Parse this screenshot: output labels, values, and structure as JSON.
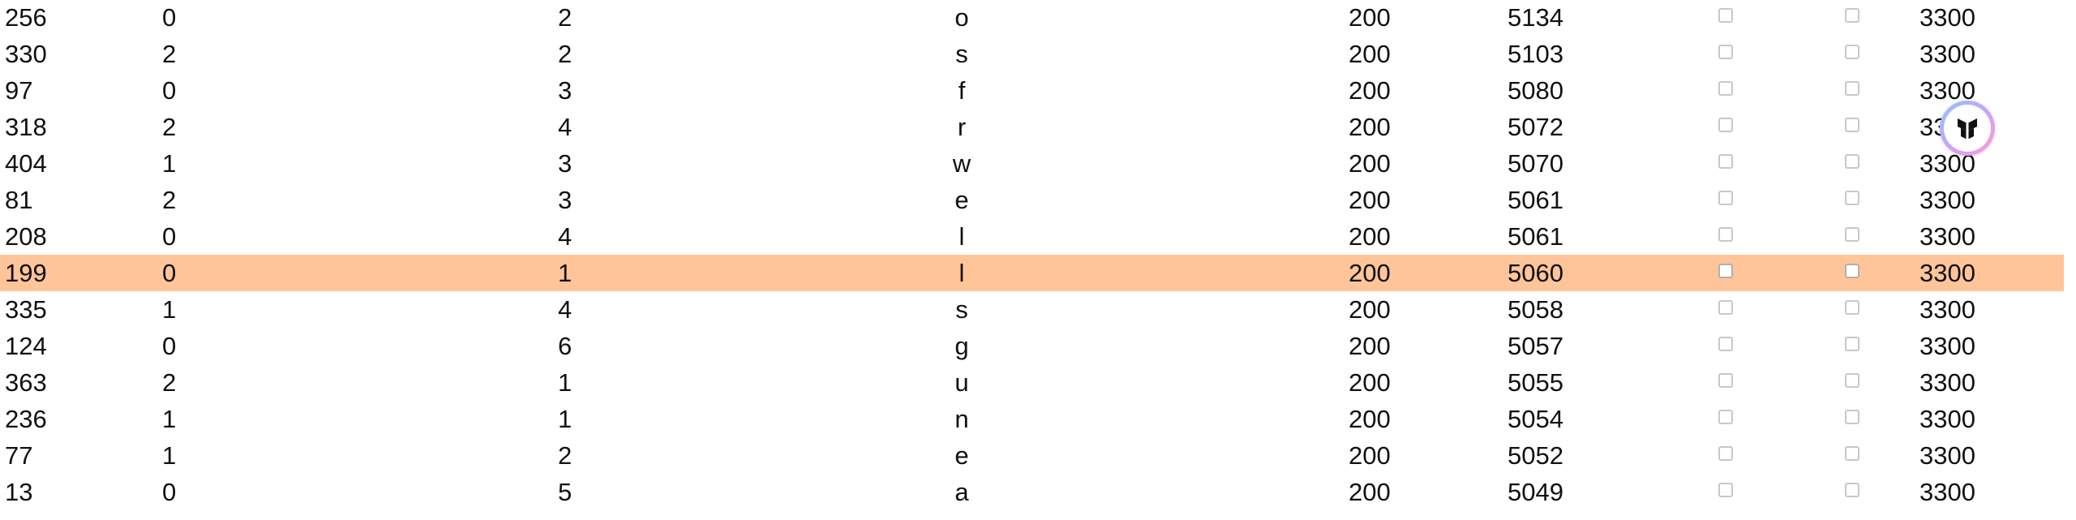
{
  "table": {
    "rows": [
      {
        "id": "256",
        "a": "0",
        "b": "2",
        "ch": "o",
        "s": "200",
        "n": "5134",
        "v": "3300"
      },
      {
        "id": "330",
        "a": "2",
        "b": "2",
        "ch": "s",
        "s": "200",
        "n": "5103",
        "v": "3300"
      },
      {
        "id": "97",
        "a": "0",
        "b": "3",
        "ch": "f",
        "s": "200",
        "n": "5080",
        "v": "3300"
      },
      {
        "id": "318",
        "a": "2",
        "b": "4",
        "ch": "r",
        "s": "200",
        "n": "5072",
        "v": "33"
      },
      {
        "id": "404",
        "a": "1",
        "b": "3",
        "ch": "w",
        "s": "200",
        "n": "5070",
        "v": "3300"
      },
      {
        "id": "81",
        "a": "2",
        "b": "3",
        "ch": "e",
        "s": "200",
        "n": "5061",
        "v": "3300"
      },
      {
        "id": "208",
        "a": "0",
        "b": "4",
        "ch": "l",
        "s": "200",
        "n": "5061",
        "v": "3300"
      },
      {
        "id": "199",
        "a": "0",
        "b": "1",
        "ch": "l",
        "s": "200",
        "n": "5060",
        "v": "3300",
        "selected": true
      },
      {
        "id": "335",
        "a": "1",
        "b": "4",
        "ch": "s",
        "s": "200",
        "n": "5058",
        "v": "3300"
      },
      {
        "id": "124",
        "a": "0",
        "b": "6",
        "ch": "g",
        "s": "200",
        "n": "5057",
        "v": "3300"
      },
      {
        "id": "363",
        "a": "2",
        "b": "1",
        "ch": "u",
        "s": "200",
        "n": "5055",
        "v": "3300"
      },
      {
        "id": "236",
        "a": "1",
        "b": "1",
        "ch": "n",
        "s": "200",
        "n": "5054",
        "v": "3300"
      },
      {
        "id": "77",
        "a": "1",
        "b": "2",
        "ch": "e",
        "s": "200",
        "n": "5052",
        "v": "3300"
      },
      {
        "id": "13",
        "a": "0",
        "b": "5",
        "ch": "a",
        "s": "200",
        "n": "5049",
        "v": "3300"
      }
    ]
  },
  "colors": {
    "selected_row": "#ffc599",
    "checkbox_border": "#c8c8c8",
    "text": "#111111"
  },
  "overlay": {
    "icon": "assistant-badge-icon"
  }
}
